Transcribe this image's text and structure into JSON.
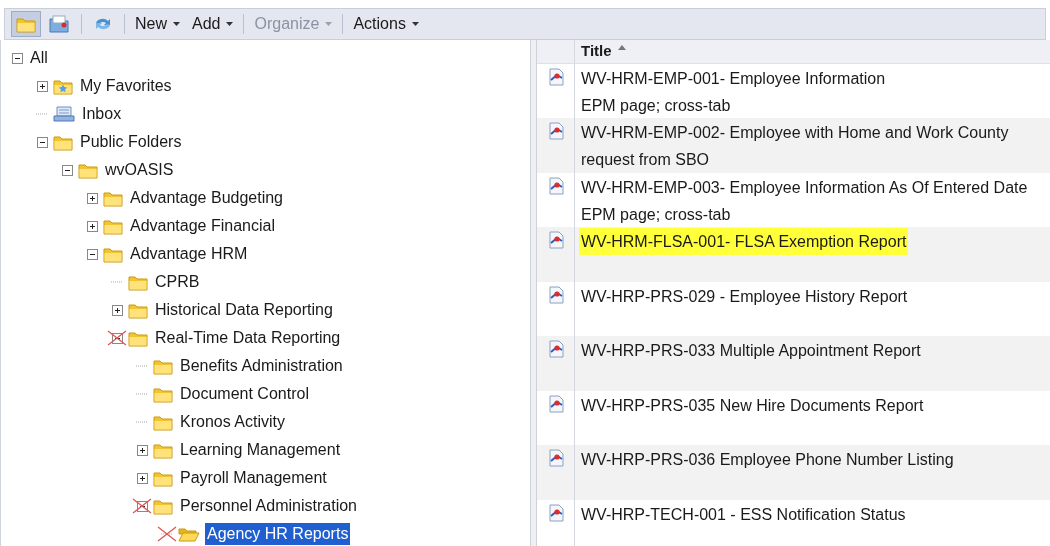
{
  "toolbar": {
    "icon_buttons": [
      {
        "kind": "folder",
        "selected": true
      },
      {
        "kind": "categories",
        "selected": false
      },
      {
        "kind": "refresh",
        "selected": false
      }
    ],
    "menus": [
      {
        "label": "New",
        "disabled": false
      },
      {
        "label": "Add",
        "disabled": false
      },
      {
        "label": "Organize",
        "disabled": true
      },
      {
        "label": "Actions",
        "disabled": false
      }
    ]
  },
  "tree": [
    {
      "label": "All",
      "expanded": true,
      "selected": false,
      "marked": false,
      "children": [
        {
          "label": "My Favorites",
          "kind": "favorites",
          "expanded": false,
          "selected": false,
          "marked": false
        },
        {
          "label": "Inbox",
          "kind": "inbox",
          "selected": false,
          "marked": false
        },
        {
          "label": "Public Folders",
          "kind": "folder",
          "expanded": true,
          "selected": false,
          "marked": false,
          "children": [
            {
              "label": "wvOASIS",
              "kind": "folder",
              "expanded": true,
              "selected": false,
              "marked": false,
              "children": [
                {
                  "label": "Advantage Budgeting",
                  "kind": "folder",
                  "expanded": false,
                  "selected": false,
                  "marked": false
                },
                {
                  "label": "Advantage Financial",
                  "kind": "folder",
                  "expanded": false,
                  "selected": false,
                  "marked": false
                },
                {
                  "label": "Advantage HRM",
                  "kind": "folder",
                  "expanded": true,
                  "selected": false,
                  "marked": false,
                  "children": [
                    {
                      "label": "CPRB",
                      "kind": "folder",
                      "selected": false,
                      "marked": false
                    },
                    {
                      "label": "Historical Data Reporting",
                      "kind": "folder",
                      "expanded": false,
                      "selected": false,
                      "marked": false
                    },
                    {
                      "label": "Real-Time Data Reporting",
                      "kind": "folder",
                      "expanded": true,
                      "selected": false,
                      "marked": true,
                      "children": [
                        {
                          "label": "Benefits Administration",
                          "kind": "folder",
                          "selected": false,
                          "marked": false
                        },
                        {
                          "label": "Document Control",
                          "kind": "folder",
                          "selected": false,
                          "marked": false
                        },
                        {
                          "label": "Kronos Activity",
                          "kind": "folder",
                          "selected": false,
                          "marked": false
                        },
                        {
                          "label": "Learning Management",
                          "kind": "folder",
                          "expanded": false,
                          "selected": false,
                          "marked": false
                        },
                        {
                          "label": "Payroll Management",
                          "kind": "folder",
                          "expanded": false,
                          "selected": false,
                          "marked": false
                        },
                        {
                          "label": "Personnel Administration",
                          "kind": "folder",
                          "expanded": true,
                          "selected": false,
                          "marked": true,
                          "children": [
                            {
                              "label": "Agency HR Reports",
                              "kind": "open-folder",
                              "selected": true,
                              "marked": true
                            }
                          ]
                        }
                      ]
                    }
                  ]
                }
              ]
            }
          ]
        }
      ]
    }
  ],
  "list": {
    "column": "Title",
    "rows": [
      {
        "title": "WV-HRM-EMP-001- Employee Information",
        "description": "EPM page; cross-tab",
        "highlighted": false
      },
      {
        "title": "WV-HRM-EMP-002- Employee with Home and Work County",
        "description": "request from SBO",
        "highlighted": false
      },
      {
        "title": "WV-HRM-EMP-003- Employee Information As Of Entered Date",
        "description": "EPM page; cross-tab",
        "highlighted": false
      },
      {
        "title": "WV-HRM-FLSA-001- FLSA Exemption Report",
        "highlighted": true
      },
      {
        "title": "WV-HRP-PRS-029 - Employee History Report",
        "highlighted": false
      },
      {
        "title": "WV-HRP-PRS-033 Multiple Appointment Report",
        "highlighted": false
      },
      {
        "title": "WV-HRP-PRS-035 New Hire Documents Report",
        "highlighted": false
      },
      {
        "title": "WV-HRP-PRS-036 Employee Phone Number Listing",
        "highlighted": false
      },
      {
        "title": "WV-HRP-TECH-001 - ESS Notification Status",
        "highlighted": false
      }
    ]
  }
}
